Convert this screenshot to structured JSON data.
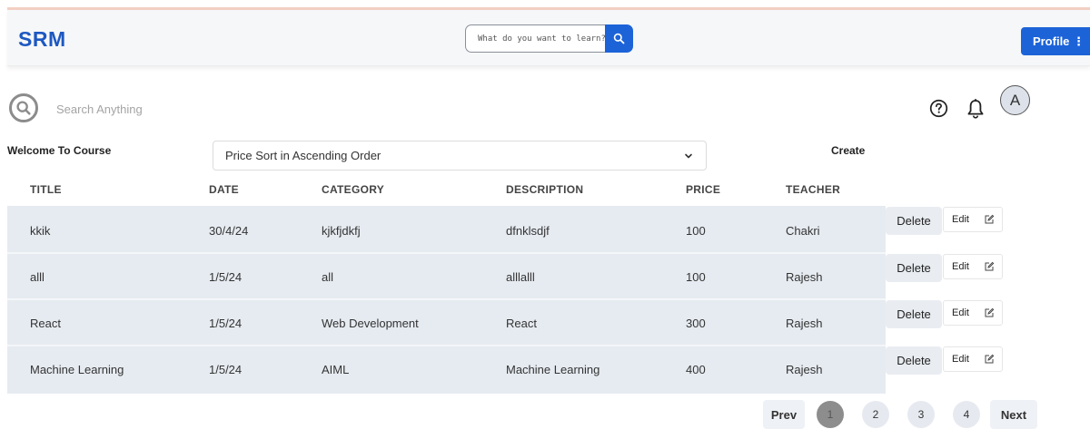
{
  "navbar": {
    "brand": "SRM",
    "search_placeholder": "What do you want to learn?",
    "profile_label": "Profile ⋮"
  },
  "toolbar": {
    "search_text": "Search Anything",
    "avatar_letter": "A"
  },
  "controls": {
    "welcome": "Welcome To Course",
    "sort_selected": "Price Sort in Ascending Order",
    "create_label": "Create"
  },
  "table": {
    "headers": [
      "TITLE",
      "DATE",
      "CATEGORY",
      "DESCRIPTION",
      "PRICE",
      "TEACHER"
    ],
    "rows": [
      {
        "title": "kkik",
        "date": "30/4/24",
        "category": "kjkfjdkfj",
        "description": "dfnklsdjf",
        "price": "100",
        "teacher": "Chakri"
      },
      {
        "title": "alll",
        "date": "1/5/24",
        "category": "all",
        "description": "alllalll",
        "price": "100",
        "teacher": "Rajesh"
      },
      {
        "title": "React",
        "date": "1/5/24",
        "category": "Web Development",
        "description": "React",
        "price": "300",
        "teacher": "Rajesh"
      },
      {
        "title": "Machine Learning",
        "date": "1/5/24",
        "category": "AIML",
        "description": "Machine Learning",
        "price": "400",
        "teacher": "Rajesh"
      }
    ],
    "delete_label": "Delete",
    "edit_label": "Edit"
  },
  "pagination": {
    "prev": "Prev",
    "pages": [
      "1",
      "2",
      "3",
      "4"
    ],
    "active": "1",
    "next": "Next"
  },
  "colors": {
    "brand": "#1d58c2",
    "primary_button": "#1c63d8",
    "table_background": "#e6ebf1"
  }
}
